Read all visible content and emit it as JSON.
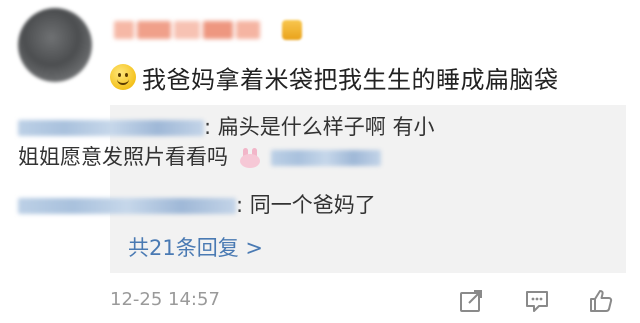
{
  "comment": {
    "text": "我爸妈拿着米袋把我生生的睡成扁脑袋",
    "timestamp": "12-25 14:57"
  },
  "replies": [
    {
      "separator": ":",
      "text": "扁头是什么样子啊 有小"
    },
    {
      "text": "姐姐愿意发照片看看吗"
    },
    {
      "separator": ":",
      "text": "同一个爸妈了"
    }
  ],
  "more_replies": "共21条回复 >",
  "icons": {
    "share": "share-icon",
    "comment": "comment-icon",
    "like": "thumbs-up-icon",
    "emoji": "smile-emoji-icon",
    "bunny": "bunny-emoji-icon"
  }
}
